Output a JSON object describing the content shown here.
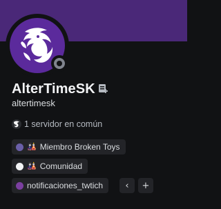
{
  "profile": {
    "display_name": "AlterTimeSK",
    "username": "altertimesk",
    "banner_color": "#4a2878",
    "avatar_icon": "white-dragon-logo",
    "status": "offline",
    "note_icon": "note-icon"
  },
  "mutual": {
    "text": "1 servidor en común"
  },
  "roles": [
    {
      "label": "Miembro Broken Toys",
      "color": "#6a5fa8",
      "emoji": "🎎"
    },
    {
      "label": "Comunidad",
      "color": "#f2f3f5",
      "emoji": "🎎"
    },
    {
      "label": "notificaciones_twtich",
      "color": "#7b3fa0"
    }
  ],
  "buttons": {
    "collapse": "‹",
    "add": "+"
  }
}
